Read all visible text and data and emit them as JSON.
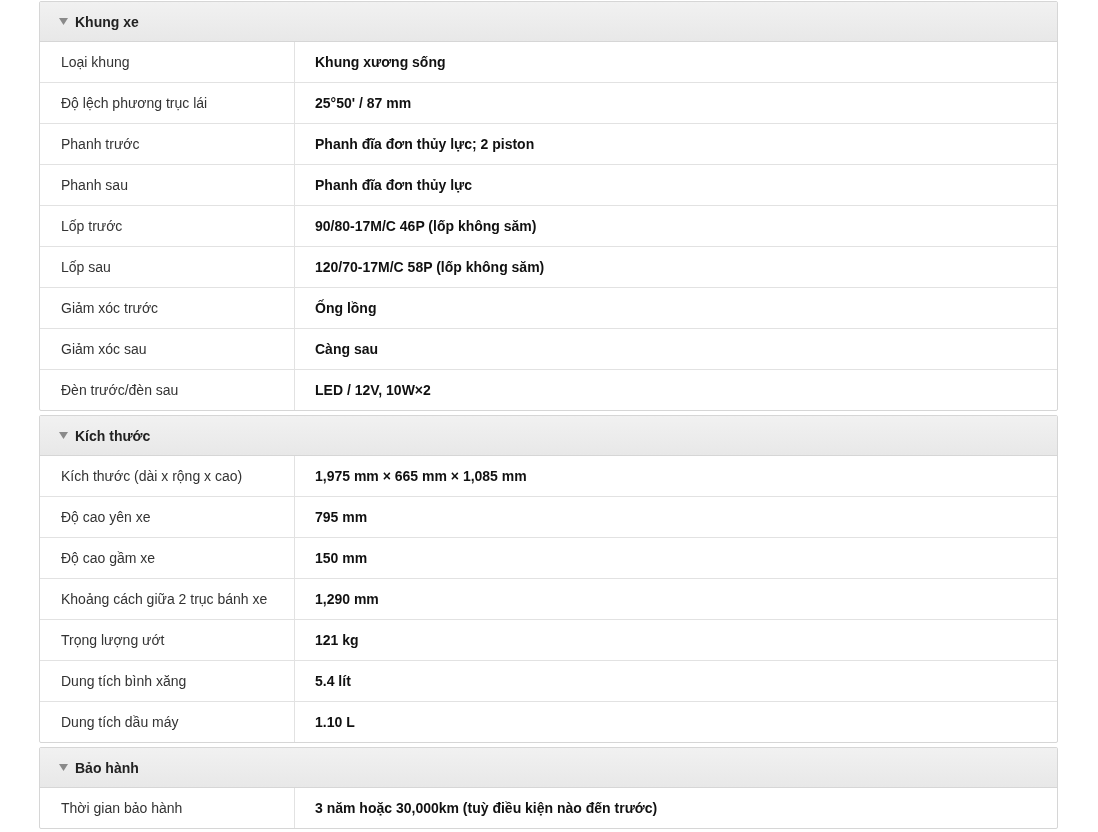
{
  "sections": [
    {
      "title": "Khung xe",
      "expanded": true,
      "rows": [
        {
          "label": "Loại khung",
          "value": "Khung xương sống"
        },
        {
          "label": "Độ lệch phương trục lái",
          "value": "25°50' / 87 mm"
        },
        {
          "label": "Phanh trước",
          "value": "Phanh đĩa đơn thủy lực; 2 piston"
        },
        {
          "label": "Phanh sau",
          "value": "Phanh đĩa đơn thủy lực"
        },
        {
          "label": "Lốp trước",
          "value": "90/80-17M/C 46P (lốp không săm)"
        },
        {
          "label": "Lốp sau",
          "value": "120/70-17M/C 58P (lốp không săm)"
        },
        {
          "label": "Giảm xóc trước",
          "value": "Ống lồng"
        },
        {
          "label": "Giảm xóc sau",
          "value": "Càng sau"
        },
        {
          "label": "Đèn trước/đèn sau",
          "value": "LED / 12V, 10W×2"
        }
      ]
    },
    {
      "title": "Kích thước",
      "expanded": true,
      "rows": [
        {
          "label": "Kích thước (dài x rộng x cao)",
          "value": "1,975 mm × 665 mm × 1,085 mm"
        },
        {
          "label": "Độ cao yên xe",
          "value": "795 mm"
        },
        {
          "label": "Độ cao gầm xe",
          "value": "150 mm"
        },
        {
          "label": "Khoảng cách giữa 2 trục bánh xe",
          "value": "1,290 mm"
        },
        {
          "label": "Trọng lượng ướt",
          "value": "121 kg"
        },
        {
          "label": "Dung tích bình xăng",
          "value": "5.4 lít"
        },
        {
          "label": "Dung tích dầu máy",
          "value": "1.10 L"
        }
      ]
    },
    {
      "title": "Bảo hành",
      "expanded": true,
      "rows": [
        {
          "label": "Thời gian bảo hành",
          "value": "3 năm hoặc 30,000km (tuỳ điều kiện nào đến trước)"
        }
      ]
    }
  ]
}
